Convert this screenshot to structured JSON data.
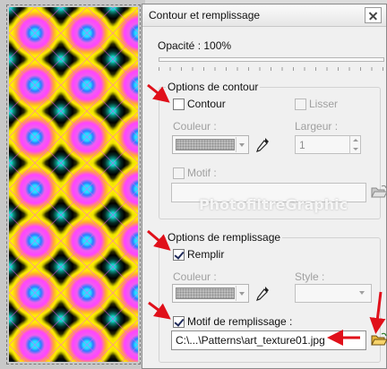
{
  "dialog": {
    "title": "Contour et remplissage",
    "opacity_label": "Opacité : 100%",
    "opacity_percent": 100
  },
  "stroke_options": {
    "group_label": "Options de contour",
    "contour": {
      "label": "Contour",
      "checked": false
    },
    "smooth": {
      "label": "Lisser",
      "checked": false
    },
    "color_label": "Couleur :",
    "width_label": "Largeur :",
    "width_value": "1",
    "pattern": {
      "label": "Motif :",
      "checked": false
    },
    "pattern_path": ""
  },
  "fill_options": {
    "group_label": "Options de remplissage",
    "fill": {
      "label": "Remplir",
      "checked": true
    },
    "color_label": "Couleur :",
    "style_label": "Style :",
    "style_value": "",
    "fill_pattern": {
      "label": "Motif de remplissage :",
      "checked": true
    },
    "pattern_path": "C:\\...\\Patterns\\art_texture01.jpg"
  },
  "watermark": "PhotofiltreGraphic",
  "colors": {
    "annotation_arrow": "#e0101a",
    "dialog_bg": "#f0f0f0"
  },
  "icons": {
    "dropper": "eyedropper-icon",
    "folder": "folder-open-icon",
    "close": "close-icon"
  }
}
